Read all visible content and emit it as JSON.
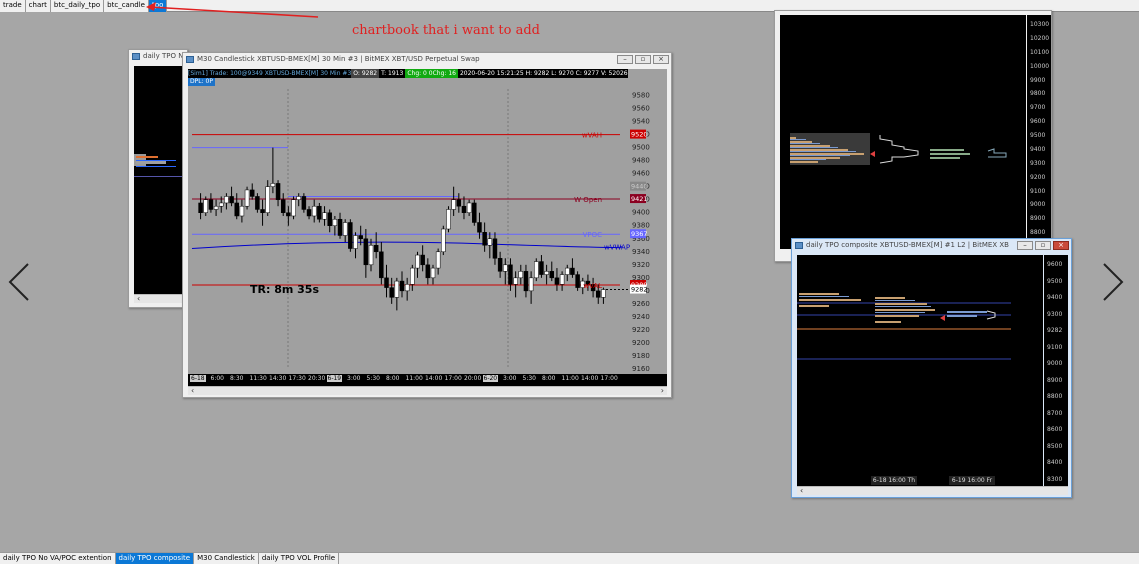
{
  "top_tabs": [
    {
      "label": "trade"
    },
    {
      "label": "chart"
    },
    {
      "label": "btc_daily_tpo"
    },
    {
      "label": "btc_candle"
    },
    {
      "label": "tpo",
      "active": true
    }
  ],
  "annotation": "chartbook that i want to add",
  "annotation_color": "#e02020",
  "bottom_tabs": [
    {
      "label": "daily TPO No VA/POC extention"
    },
    {
      "label": "daily TPO composite",
      "active": true
    },
    {
      "label": "M30 Candlestick"
    },
    {
      "label": "daily TPO VOL Profile"
    }
  ],
  "win_left": {
    "title": "daily TPO No"
  },
  "win_main": {
    "title": "M30 Candlestick  XBTUSD-BMEX[M]  30 Min   #3 | BitMEX XBT/USD Perpetual Swap",
    "header": "[Sim1]  Trade: 100@9349  XBTUSD-BMEX[M]  30 Min  #3",
    "header_cells": [
      "O: 9282",
      "T: 1913",
      "Chg: 0 0Chg: 16",
      "2020-06-20 15:21:25 H: 9282 L: 9270 C: 9277 V: 5202618 B: 92"
    ],
    "dpl": "DPL: 0P",
    "timer": "TR: 8m 35s",
    "prices": [
      "9580",
      "9560",
      "9540",
      "9520",
      "9500",
      "9480",
      "9460",
      "9440",
      "9420",
      "9400",
      "9380",
      "9360",
      "9340",
      "9320",
      "9300",
      "9280",
      "9260",
      "9240",
      "9220",
      "9200",
      "9180",
      "9160"
    ],
    "line_labels": {
      "wvah": "wVAH",
      "wvah_val": "9520",
      "wopen": "W Open",
      "wopen_val": "9421",
      "vpoc": "VPOC",
      "vpoc_val": "9367",
      "wvwap": "wVWAP",
      "wval": "wVAL",
      "wval_val": "9289",
      "last": "9282",
      "prior": "9440"
    },
    "time_labels": [
      "6-18",
      "6:00",
      "8:30",
      "11:30",
      "14:30",
      "17:30",
      "20:30",
      "6-19",
      "3:00",
      "5:30",
      "8:00",
      "11:00",
      "14:00",
      "17:00",
      "20:00",
      "6-20",
      "3:00",
      "5:30",
      "8:00",
      "11:00",
      "14:00",
      "17:00"
    ],
    "colors": {
      "bg": "#a0a0a0",
      "up": "#ffffff",
      "down": "#000000",
      "wvah": "#cc0000",
      "wopen": "#8b0020",
      "wvwap": "#0000cc",
      "wval": "#cc0000"
    }
  },
  "win_tr": {
    "prices": [
      "10300",
      "10200",
      "10100",
      "10000",
      "9900",
      "9800",
      "9700",
      "9600",
      "9500",
      "9400",
      "9300",
      "9200",
      "9100",
      "9000",
      "8900",
      "8800",
      "8700"
    ]
  },
  "win_br": {
    "title": "daily TPO composite  XBTUSD-BMEX[M]  #1  L2 | BitMEX XBT/...",
    "prices": [
      "9600",
      "9500",
      "9400",
      "9300",
      "9282",
      "9100",
      "9000",
      "8900",
      "8800",
      "8700",
      "8600",
      "8500",
      "8400",
      "8300"
    ],
    "time_labels": [
      "6-18  16:00 Th",
      "6-19  16:00 Fr"
    ]
  },
  "chart_data": {
    "type": "candlestick",
    "title": "M30 Candlestick  XBTUSD-BMEX[M]  30 Min",
    "ylim": [
      9160,
      9590
    ],
    "candles": [
      [
        9415,
        9430,
        9390,
        9400
      ],
      [
        9400,
        9425,
        9395,
        9420
      ],
      [
        9420,
        9430,
        9400,
        9405
      ],
      [
        9405,
        9420,
        9395,
        9410
      ],
      [
        9410,
        9425,
        9400,
        9415
      ],
      [
        9415,
        9430,
        9405,
        9425
      ],
      [
        9425,
        9440,
        9410,
        9415
      ],
      [
        9415,
        9430,
        9390,
        9395
      ],
      [
        9395,
        9420,
        9385,
        9410
      ],
      [
        9410,
        9440,
        9405,
        9435
      ],
      [
        9435,
        9445,
        9420,
        9425
      ],
      [
        9425,
        9430,
        9400,
        9405
      ],
      [
        9405,
        9420,
        9380,
        9400
      ],
      [
        9400,
        9450,
        9395,
        9440
      ],
      [
        9440,
        9500,
        9430,
        9445
      ],
      [
        9445,
        9450,
        9410,
        9420
      ],
      [
        9420,
        9430,
        9395,
        9400
      ],
      [
        9400,
        9410,
        9380,
        9395
      ],
      [
        9395,
        9425,
        9390,
        9420
      ],
      [
        9420,
        9430,
        9410,
        9425
      ],
      [
        9425,
        9430,
        9400,
        9405
      ],
      [
        9405,
        9410,
        9390,
        9395
      ],
      [
        9395,
        9420,
        9385,
        9410
      ],
      [
        9410,
        9415,
        9385,
        9390
      ],
      [
        9390,
        9410,
        9380,
        9400
      ],
      [
        9400,
        9405,
        9370,
        9380
      ],
      [
        9380,
        9395,
        9365,
        9390
      ],
      [
        9390,
        9400,
        9360,
        9365
      ],
      [
        9365,
        9390,
        9355,
        9385
      ],
      [
        9385,
        9390,
        9340,
        9345
      ],
      [
        9345,
        9370,
        9330,
        9365
      ],
      [
        9365,
        9380,
        9350,
        9360
      ],
      [
        9360,
        9375,
        9300,
        9320
      ],
      [
        9320,
        9360,
        9310,
        9350
      ],
      [
        9350,
        9370,
        9330,
        9340
      ],
      [
        9340,
        9355,
        9290,
        9300
      ],
      [
        9300,
        9320,
        9270,
        9285
      ],
      [
        9285,
        9300,
        9260,
        9270
      ],
      [
        9270,
        9300,
        9250,
        9295
      ],
      [
        9295,
        9310,
        9270,
        9280
      ],
      [
        9280,
        9300,
        9265,
        9290
      ],
      [
        9290,
        9320,
        9280,
        9315
      ],
      [
        9315,
        9340,
        9300,
        9335
      ],
      [
        9335,
        9350,
        9310,
        9320
      ],
      [
        9320,
        9330,
        9290,
        9300
      ],
      [
        9300,
        9320,
        9290,
        9315
      ],
      [
        9315,
        9345,
        9305,
        9340
      ],
      [
        9340,
        9380,
        9335,
        9375
      ],
      [
        9375,
        9410,
        9370,
        9405
      ],
      [
        9405,
        9440,
        9395,
        9420
      ],
      [
        9420,
        9430,
        9400,
        9410
      ],
      [
        9410,
        9425,
        9390,
        9400
      ],
      [
        9400,
        9420,
        9395,
        9415
      ],
      [
        9415,
        9420,
        9380,
        9385
      ],
      [
        9385,
        9400,
        9360,
        9370
      ],
      [
        9370,
        9385,
        9340,
        9350
      ],
      [
        9350,
        9370,
        9330,
        9360
      ],
      [
        9360,
        9370,
        9320,
        9330
      ],
      [
        9330,
        9340,
        9300,
        9310
      ],
      [
        9310,
        9330,
        9290,
        9320
      ],
      [
        9320,
        9330,
        9280,
        9290
      ],
      [
        9290,
        9310,
        9270,
        9300
      ],
      [
        9300,
        9320,
        9290,
        9310
      ],
      [
        9310,
        9320,
        9270,
        9280
      ],
      [
        9280,
        9310,
        9260,
        9300
      ],
      [
        9300,
        9330,
        9295,
        9325
      ],
      [
        9325,
        9335,
        9300,
        9305
      ],
      [
        9305,
        9320,
        9290,
        9310
      ],
      [
        9310,
        9325,
        9295,
        9300
      ],
      [
        9300,
        9315,
        9280,
        9290
      ],
      [
        9290,
        9310,
        9280,
        9305
      ],
      [
        9305,
        9320,
        9295,
        9315
      ],
      [
        9315,
        9330,
        9300,
        9305
      ],
      [
        9305,
        9310,
        9280,
        9285
      ],
      [
        9285,
        9300,
        9275,
        9295
      ],
      [
        9295,
        9305,
        9280,
        9290
      ],
      [
        9290,
        9300,
        9270,
        9280
      ],
      [
        9280,
        9290,
        9260,
        9270
      ],
      [
        9270,
        9285,
        9260,
        9282
      ]
    ]
  }
}
